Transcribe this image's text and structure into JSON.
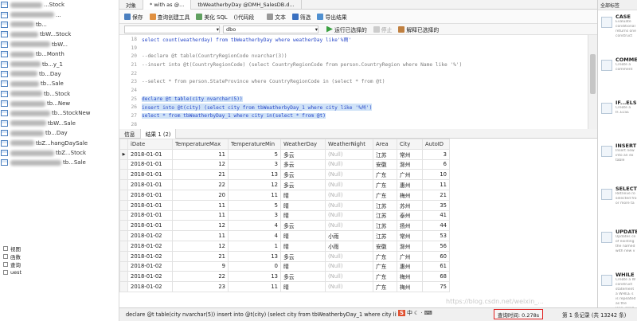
{
  "sidebar": {
    "items": [
      {
        "label": "...Stock",
        "blur": 40
      },
      {
        "label": "...",
        "blur": 55
      },
      {
        "label": "tb...",
        "blur": 30
      },
      {
        "label": "tbW...Stock",
        "blur": 35
      },
      {
        "label": "tbW...",
        "blur": 50
      },
      {
        "label": "tb...Month",
        "blur": 30
      },
      {
        "label": "tb...y_1",
        "blur": 38
      },
      {
        "label": "tb...Day",
        "blur": 34
      },
      {
        "label": "tb...Sale",
        "blur": 36
      },
      {
        "label": "tb...Stock",
        "blur": 40
      },
      {
        "label": "tb...New",
        "blur": 44
      },
      {
        "label": "tb...StockNew",
        "blur": 50
      },
      {
        "label": "tbW...Sale",
        "blur": 45
      },
      {
        "label": "tb...Day",
        "blur": 42
      },
      {
        "label": "tbZ...hangDaySale",
        "blur": 30
      },
      {
        "label": "tbZ...Stock",
        "blur": 55
      },
      {
        "label": "tb...Sale",
        "blur": 64
      }
    ],
    "object_items": [
      "视图",
      "函数",
      "查询",
      "uest"
    ]
  },
  "tabs": [
    "对象",
    "* with as @...",
    "tbWeatherbyDay @DMH_SalesDB.d..."
  ],
  "toolbar": {
    "save": "保存",
    "query_builder": "查询创建工具",
    "beautify": "美化 SQL",
    "snippet": "()代码段",
    "text": "文本",
    "filter": "筛选",
    "export": "导出结果"
  },
  "toolbar2": {
    "db": "dbo",
    "run_selected": "运行已选择的",
    "stop": "停止",
    "explain": "解释已选择的"
  },
  "editor_lines": [
    {
      "n": "18",
      "t": "select count(weatherday) from tbWeatherbyDay where weatherDay like'%雨'",
      "c": "code"
    },
    {
      "n": "19",
      "t": "",
      "c": ""
    },
    {
      "n": "20",
      "t": "--declare @t table(CountryRegionCode nvarchar(3))",
      "c": "cm"
    },
    {
      "n": "21",
      "t": "--insert into @t(CountryRegionCode) (select CountryRegionCode from person.CountryRegion where Name like '%')",
      "c": "cm"
    },
    {
      "n": "22",
      "t": "",
      "c": ""
    },
    {
      "n": "23",
      "t": "--select * from person.StateProvince where CountryRegionCode in (select * from @t)",
      "c": "cm"
    },
    {
      "n": "24",
      "t": "",
      "c": ""
    },
    {
      "n": "25",
      "t": "declare @t table(city nvarchar(5))",
      "c": "hl"
    },
    {
      "n": "26",
      "t": "insert into @t(city) (select city from tbWeatherbyDay_1 where city like '%州')",
      "c": "hl"
    },
    {
      "n": "27",
      "t": "select * from tbWeatherbyDay_1 where city in(select * from @t)",
      "c": "hl"
    },
    {
      "n": "28",
      "t": "",
      "c": ""
    },
    {
      "n": "29",
      "t": "--with",
      "c": "cm"
    },
    {
      "n": "30",
      "t": "",
      "c": ""
    },
    {
      "n": "31",
      "t": "--cr as",
      "c": "cm"
    }
  ],
  "result_tabs": [
    "信息",
    "结果 1 (2)"
  ],
  "columns": [
    "iDate",
    "TemperatureMax",
    "TemperatureMin",
    "WeatherDay",
    "WeatherNight",
    "Area",
    "City",
    "AutoID"
  ],
  "rows": [
    [
      "2018-01-01",
      "11",
      "5",
      "多云",
      "(Null)",
      "江苏",
      "常州",
      "3"
    ],
    [
      "2018-01-01",
      "12",
      "3",
      "多云",
      "(Null)",
      "安徽",
      "滁州",
      "6"
    ],
    [
      "2018-01-01",
      "21",
      "13",
      "多云",
      "(Null)",
      "广东",
      "广州",
      "10"
    ],
    [
      "2018-01-01",
      "22",
      "12",
      "多云",
      "(Null)",
      "广东",
      "惠州",
      "11"
    ],
    [
      "2018-01-01",
      "20",
      "11",
      "晴",
      "(Null)",
      "广东",
      "梅州",
      "21"
    ],
    [
      "2018-01-01",
      "11",
      "5",
      "晴",
      "(Null)",
      "江苏",
      "苏州",
      "35"
    ],
    [
      "2018-01-01",
      "11",
      "3",
      "晴",
      "(Null)",
      "江苏",
      "泰州",
      "41"
    ],
    [
      "2018-01-01",
      "12",
      "4",
      "多云",
      "(Null)",
      "江苏",
      "扬州",
      "44"
    ],
    [
      "2018-01-02",
      "11",
      "4",
      "晴",
      "小雨",
      "江苏",
      "常州",
      "53"
    ],
    [
      "2018-01-02",
      "12",
      "1",
      "晴",
      "小雨",
      "安徽",
      "滁州",
      "56"
    ],
    [
      "2018-01-02",
      "21",
      "13",
      "多云",
      "(Null)",
      "广东",
      "广州",
      "60"
    ],
    [
      "2018-01-02",
      "9",
      "0",
      "晴",
      "(Null)",
      "广东",
      "惠州",
      "61"
    ],
    [
      "2018-01-02",
      "22",
      "13",
      "多云",
      "(Null)",
      "广东",
      "梅州",
      "68"
    ],
    [
      "2018-01-02",
      "23",
      "11",
      "晴",
      "(Null)",
      "广东",
      "梅州",
      "75"
    ]
  ],
  "right_panel": {
    "header": "全部标签",
    "snippets": [
      {
        "title": "CASE",
        "desc": [
          "Evaluate",
          "conditional",
          "returns one",
          "construct"
        ]
      },
      {
        "title": "COMME",
        "desc": [
          "Create a",
          "comment"
        ]
      },
      {
        "title": "IF...ELSE",
        "desc": [
          "Create a",
          "IF..ELSE"
        ]
      },
      {
        "title": "INSERT",
        "desc": [
          "Insert new",
          "into an ex",
          "table"
        ]
      },
      {
        "title": "SELECT",
        "desc": [
          "Retrieve ro",
          "selected fro",
          "or more ta"
        ]
      },
      {
        "title": "UPDATE",
        "desc": [
          "Updates ce",
          "of existing",
          "the named",
          "with new v"
        ]
      },
      {
        "title": "WHILE",
        "desc": [
          "Create a W",
          "construct",
          "statement",
          "a WHILE s",
          "is repeated",
          "as the",
          "loop_cond",
          "expression"
        ]
      }
    ]
  },
  "status": {
    "sql": "declare @t table(city nvarchar(5)) insert into @t(city) (select city from tbWeatherbyDay_1 where city like",
    "query_time": "查询时间: 0.278s",
    "records": "第 1 条记录 (共 13242 条)"
  },
  "watermark": "https://blog.csdn.net/weixin_..."
}
